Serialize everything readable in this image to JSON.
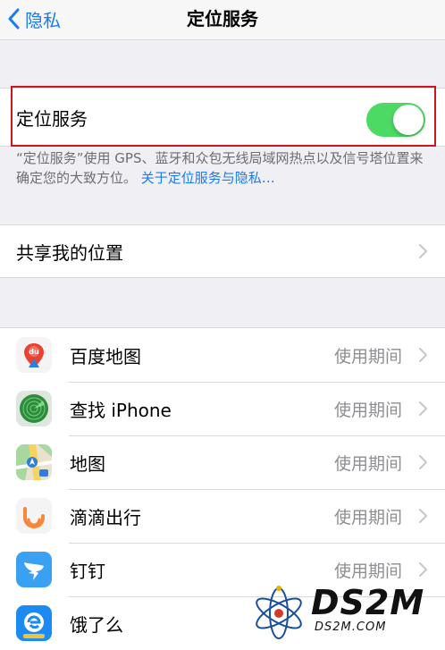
{
  "nav": {
    "back_label": "隐私",
    "title": "定位服务"
  },
  "location": {
    "label": "定位服务",
    "enabled": true
  },
  "note": {
    "text": "“定位服务”使用 GPS、蓝牙和众包无线局域网热点以及信号塔位置来确定您的大致方位。",
    "link": "关于定位服务与隐私…"
  },
  "share": {
    "label": "共享我的位置"
  },
  "apps": [
    {
      "name": "百度地图",
      "status": "使用期间",
      "icon": "baidu-maps-icon"
    },
    {
      "name": "查找 iPhone",
      "status": "使用期间",
      "icon": "find-iphone-icon"
    },
    {
      "name": "地图",
      "status": "使用期间",
      "icon": "apple-maps-icon"
    },
    {
      "name": "滴滴出行",
      "status": "使用期间",
      "icon": "didi-icon"
    },
    {
      "name": "钉钉",
      "status": "使用期间",
      "icon": "dingtalk-icon"
    },
    {
      "name": "饿了么",
      "status": "",
      "icon": "eleme-icon"
    }
  ],
  "watermark": {
    "brand": "DS2M",
    "site": "DS2M.COM"
  },
  "colors": {
    "accent": "#1a7cf5",
    "toggle_on": "#4cd964",
    "highlight": "#c8171e"
  }
}
